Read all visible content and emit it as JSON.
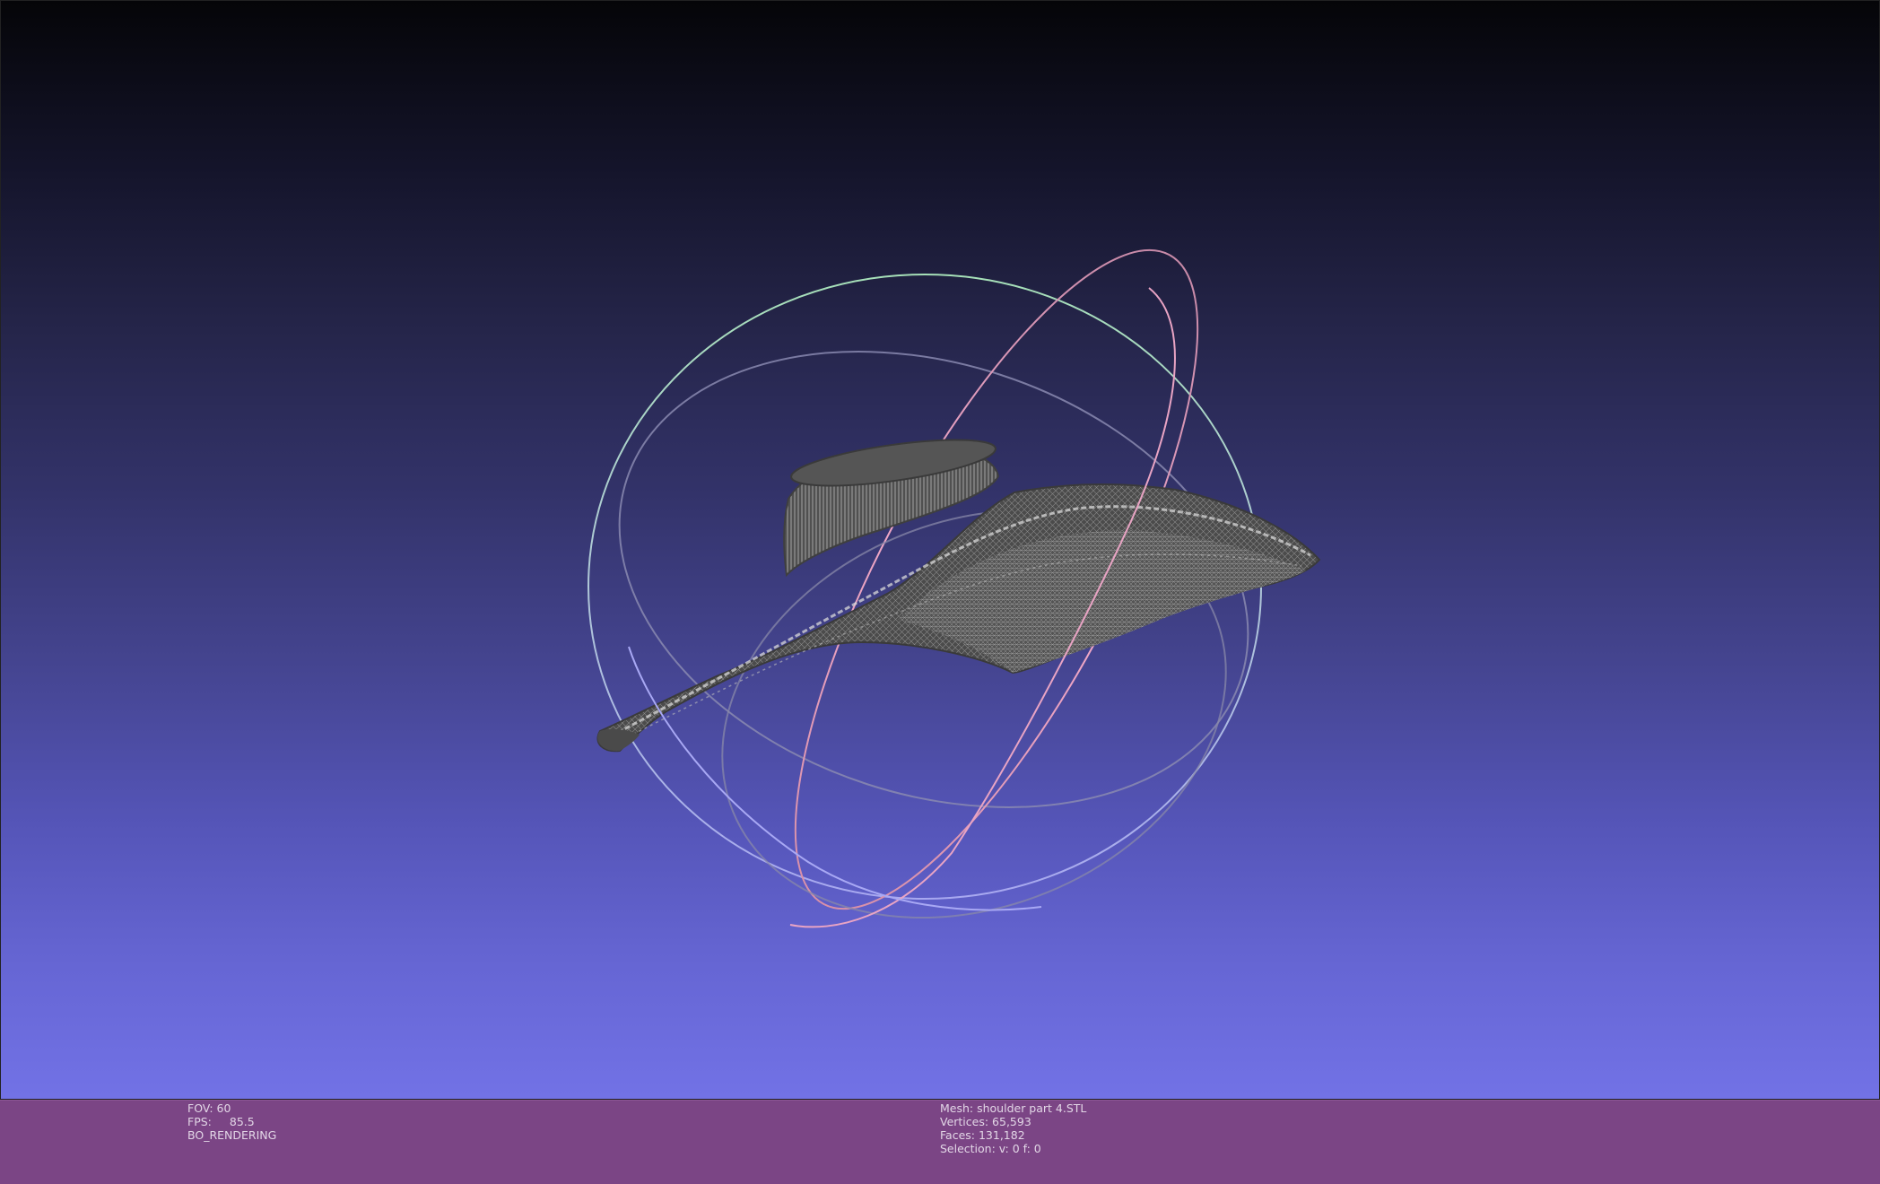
{
  "render_info": {
    "fov_label": "FOV:",
    "fov_value": "60",
    "fps_label": "FPS:",
    "fps_value": "85.5",
    "mode": "BO_RENDERING"
  },
  "mesh_info": {
    "mesh": "Mesh: shoulder part 4.STL",
    "vertices": "Vertices: 65,593",
    "faces": "Faces: 131,182",
    "selection": "Selection: v: 0 f: 0"
  },
  "colors": {
    "status_bar": "#7b4585",
    "mesh": "#4a4a4a",
    "trackball_green": "#9fd8b4",
    "trackball_pink": "#e8a0c0",
    "trackball_blue": "#a8a8f0",
    "trackball_gray": "#8a8aa8"
  },
  "icons": {
    "trackball": "trackball-gizmo-icon"
  }
}
